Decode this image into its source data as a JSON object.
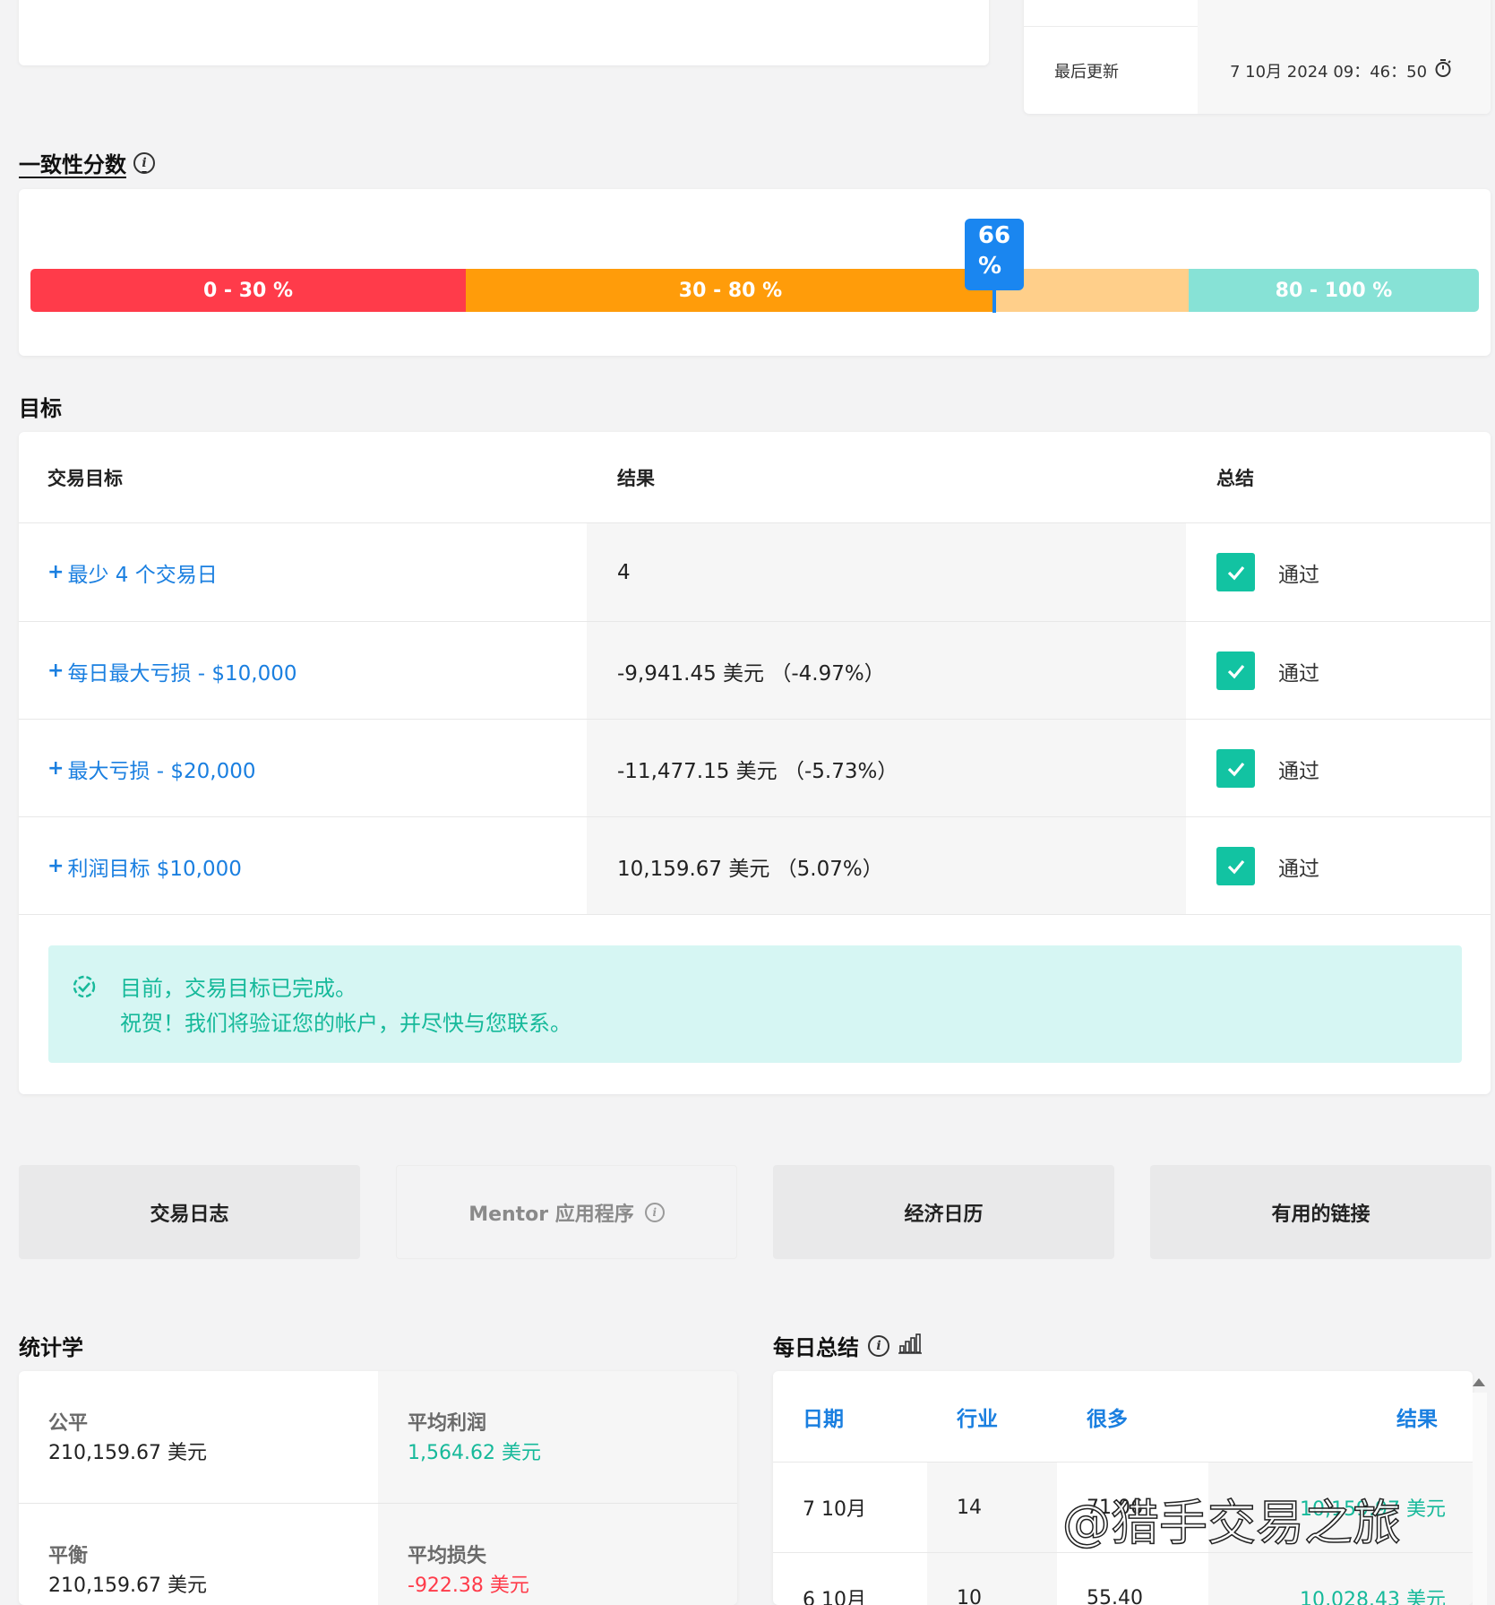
{
  "info_panel": {
    "last_updated_label": "最后更新",
    "last_updated_value": "7 10月 2024 09：46：50",
    "timer_icon": "stopwatch-icon"
  },
  "consistency": {
    "title": "一致性分数",
    "info_icon": "info-icon",
    "segments": [
      {
        "label": "0 - 30 %",
        "color": "#ff3b4a"
      },
      {
        "label": "30 - 80 %",
        "color": "#ff9c0a"
      },
      {
        "label": "",
        "color": "#ffcf8a"
      },
      {
        "label": "80 - 100 %",
        "color": "#87e2d6"
      }
    ],
    "score_value": "66",
    "score_unit": "%",
    "score_fraction": 0.66,
    "marker_color": "#1a86f0"
  },
  "goals": {
    "title": "目标",
    "headers": {
      "goal": "交易目标",
      "result": "结果",
      "summary": "总结"
    },
    "rows": [
      {
        "goal": "最少 4 个交易日",
        "result": "4",
        "status": "通过"
      },
      {
        "goal": "每日最大亏损 - $10,000",
        "result": "-9,941.45 美元 （-4.97%）",
        "status": "通过"
      },
      {
        "goal": "最大亏损 - $20,000",
        "result": "-11,477.15 美元 （-5.73%）",
        "status": "通过"
      },
      {
        "goal": "利润目标 $10,000",
        "result": "10,159.67 美元 （5.07%）",
        "status": "通过"
      }
    ],
    "success_line1": "目前，交易目标已完成。",
    "success_line2": "祝贺！我们将验证您的帐户，并尽快与您联系。",
    "success_color": "#16b99a"
  },
  "tabs": {
    "journal": "交易日志",
    "mentor": "Mentor 应用程序",
    "calendar": "经济日历",
    "links": "有用的链接"
  },
  "stats": {
    "title": "统计学",
    "equity_label": "公平",
    "equity_value": "210,159.67 美元",
    "avg_profit_label": "平均利润",
    "avg_profit_value": "1,564.62 美元",
    "balance_label": "平衡",
    "balance_value": "210,159.67 美元",
    "avg_loss_label": "平均损失",
    "avg_loss_value": "-922.38 美元"
  },
  "daily": {
    "title": "每日总结",
    "headers": {
      "date": "日期",
      "trades": "行业",
      "lots": "很多",
      "result": "结果"
    },
    "rows": [
      {
        "date": "7 10月",
        "trades": "14",
        "lots": "71.06",
        "result": "10,159.97 美元"
      },
      {
        "date": "6 10月",
        "trades": "10",
        "lots": "55.40",
        "result": "10,028.43 美元"
      }
    ]
  },
  "watermark": "@猎手交易之旅"
}
